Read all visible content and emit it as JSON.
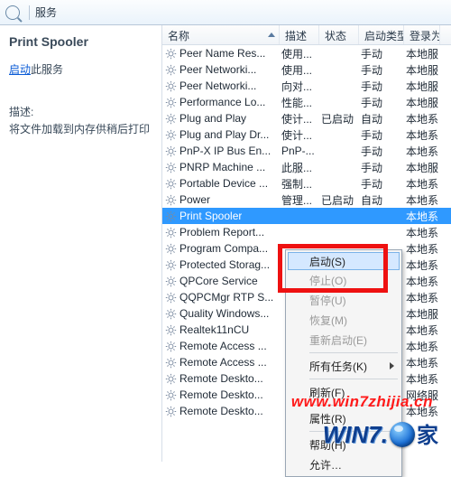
{
  "toolbar": {
    "search_label": "服务"
  },
  "left": {
    "title": "Print Spooler",
    "start_link": "启动",
    "start_suffix": "此服务",
    "desc_label": "描述:",
    "desc_text": "将文件加载到内存供稍后打印"
  },
  "columns": {
    "name": "名称",
    "desc": "描述",
    "status": "状态",
    "startup": "启动类型",
    "logon": "登录为"
  },
  "rows": [
    {
      "name": "Peer Name Res...",
      "desc": "使用...",
      "status": "",
      "startup": "手动",
      "logon": "本地服"
    },
    {
      "name": "Peer Networki...",
      "desc": "使用...",
      "status": "",
      "startup": "手动",
      "logon": "本地服"
    },
    {
      "name": "Peer Networki...",
      "desc": "向对...",
      "status": "",
      "startup": "手动",
      "logon": "本地服"
    },
    {
      "name": "Performance Lo...",
      "desc": "性能...",
      "status": "",
      "startup": "手动",
      "logon": "本地服"
    },
    {
      "name": "Plug and Play",
      "desc": "使计...",
      "status": "已启动",
      "startup": "自动",
      "logon": "本地系"
    },
    {
      "name": "Plug and Play Dr...",
      "desc": "使计...",
      "status": "",
      "startup": "手动",
      "logon": "本地系"
    },
    {
      "name": "PnP-X IP Bus En...",
      "desc": "PnP-...",
      "status": "",
      "startup": "手动",
      "logon": "本地系"
    },
    {
      "name": "PNRP Machine ...",
      "desc": "此服...",
      "status": "",
      "startup": "手动",
      "logon": "本地服"
    },
    {
      "name": "Portable Device ...",
      "desc": "强制...",
      "status": "",
      "startup": "手动",
      "logon": "本地系"
    },
    {
      "name": "Power",
      "desc": "管理...",
      "status": "已启动",
      "startup": "自动",
      "logon": "本地系"
    },
    {
      "name": "Print Spooler",
      "desc": "",
      "status": "",
      "startup": "",
      "logon": "本地系",
      "selected": true
    },
    {
      "name": "Problem Report...",
      "desc": "",
      "status": "",
      "startup": "",
      "logon": "本地系"
    },
    {
      "name": "Program Compa...",
      "desc": "",
      "status": "",
      "startup": "",
      "logon": "本地系"
    },
    {
      "name": "Protected Storag...",
      "desc": "",
      "status": "",
      "startup": "",
      "logon": "本地系"
    },
    {
      "name": "QPCore Service",
      "desc": "",
      "status": "",
      "startup": "",
      "logon": "本地系"
    },
    {
      "name": "QQPCMgr RTP S...",
      "desc": "",
      "status": "",
      "startup": "",
      "logon": "本地系"
    },
    {
      "name": "Quality Windows...",
      "desc": "",
      "status": "",
      "startup": "",
      "logon": "本地服"
    },
    {
      "name": "Realtek11nCU",
      "desc": "",
      "status": "",
      "startup": "",
      "logon": "本地系"
    },
    {
      "name": "Remote Access ...",
      "desc": "",
      "status": "",
      "startup": "",
      "logon": "本地系"
    },
    {
      "name": "Remote Access ...",
      "desc": "",
      "status": "",
      "startup": "",
      "logon": "本地系"
    },
    {
      "name": "Remote Deskto...",
      "desc": "",
      "status": "",
      "startup": "",
      "logon": "本地系"
    },
    {
      "name": "Remote Deskto...",
      "desc": "",
      "status": "",
      "startup": "",
      "logon": "网络服"
    },
    {
      "name": "Remote Deskto...",
      "desc": "",
      "status": "",
      "startup": "",
      "logon": "本地系"
    }
  ],
  "context_menu": {
    "start": "启动(S)",
    "stop": "停止(O)",
    "pause": "暂停(U)",
    "resume": "恢复(M)",
    "restart": "重新启动(E)",
    "all_tasks": "所有任务(K)",
    "refresh": "刷新(F)",
    "properties": "属性(R)",
    "help": "帮助(H)",
    "allow": "允许…"
  },
  "watermark": {
    "url": "www.win7zhijia.cn",
    "logo1": "WIN7.",
    "logo2": "家"
  }
}
